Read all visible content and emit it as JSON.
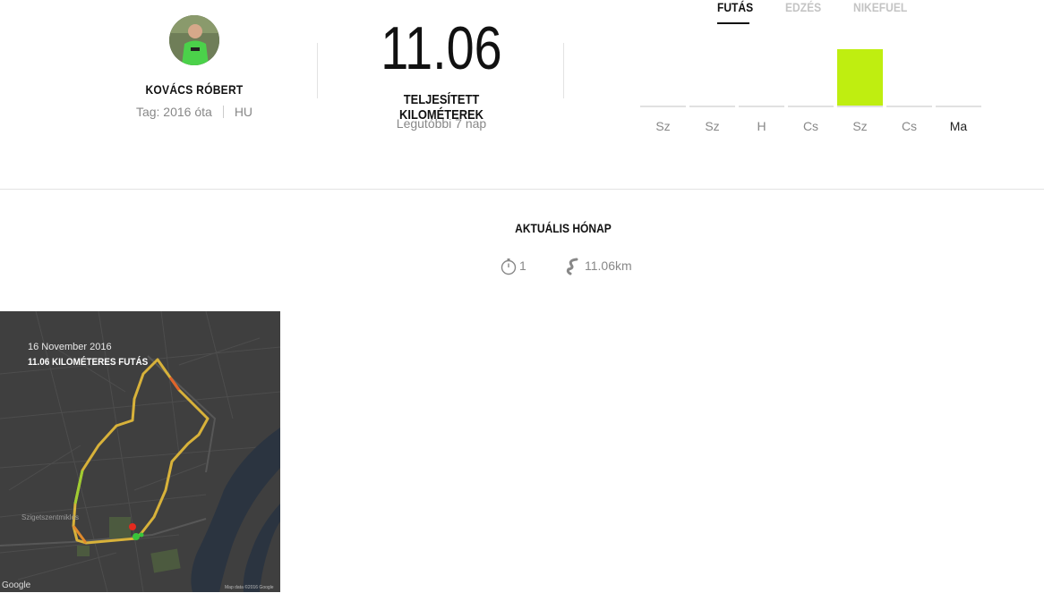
{
  "profile": {
    "name": "KOVÁCS RÓBERT",
    "member_since": "Tag: 2016 óta",
    "country": "HU"
  },
  "summary": {
    "total_km": "11.06",
    "label": "TELJESÍTETT KILOMÉTEREK",
    "period": "Legutóbbi 7 nap"
  },
  "tabs": [
    {
      "label": "FUTÁS",
      "active": true
    },
    {
      "label": "EDZÉS",
      "active": false
    },
    {
      "label": "NIKEFUEL",
      "active": false
    }
  ],
  "chart_data": {
    "type": "bar",
    "categories": [
      "Sz",
      "Sz",
      "H",
      "Cs",
      "Sz",
      "Cs",
      "Ma"
    ],
    "values": [
      0,
      0,
      0,
      0,
      11.06,
      0,
      0
    ],
    "ylim": [
      0,
      11.06
    ],
    "bar_color": "#bfee10"
  },
  "month": {
    "title": "AKTUÁLIS HÓNAP",
    "runs": "1",
    "distance": "11.06km",
    "runs_icon": "stopwatch-icon",
    "distance_icon": "route-icon"
  },
  "activity": {
    "date": "16 November 2016",
    "title": "11.06 KILOMÉTERES FUTÁS",
    "map_place_label": "Szigetszentmiklós",
    "map_logo": "Google",
    "map_credit": "Map data ©2016 Google"
  }
}
